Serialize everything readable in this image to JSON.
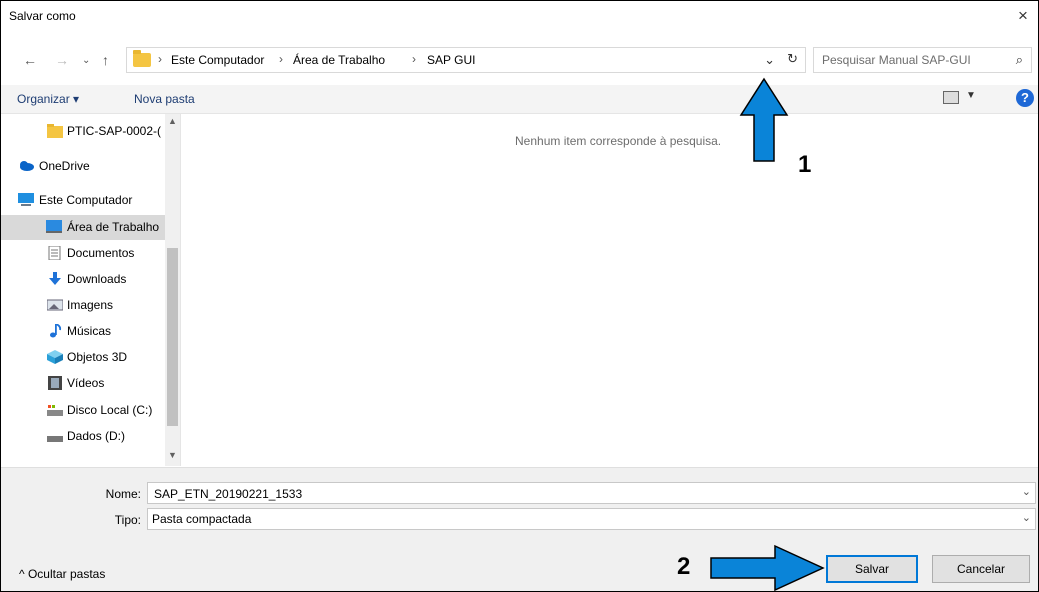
{
  "window": {
    "title": "Salvar como",
    "close_glyph": "×"
  },
  "address": {
    "segments": [
      "Este Computador",
      "Área de Trabalho",
      "SAP GUI"
    ],
    "separator": "›"
  },
  "search": {
    "placeholder": "Pesquisar Manual SAP-GUI"
  },
  "toolbar": {
    "organize_label": "Organizar ▾",
    "new_folder_label": "Nova pasta",
    "help_glyph": "?"
  },
  "nav_items": [
    {
      "label": "PTIC-SAP-0002-(",
      "icon": "folder-icon"
    },
    {
      "label": "OneDrive",
      "icon": "cloud-icon"
    },
    {
      "label": "Este Computador",
      "icon": "computer-icon"
    },
    {
      "label": "Área de Trabalho",
      "icon": "desktop-icon"
    },
    {
      "label": "Documentos",
      "icon": "document-icon"
    },
    {
      "label": "Downloads",
      "icon": "download-icon"
    },
    {
      "label": "Imagens",
      "icon": "image-icon"
    },
    {
      "label": "Músicas",
      "icon": "music-icon"
    },
    {
      "label": "Objetos 3D",
      "icon": "cube-icon"
    },
    {
      "label": "Vídeos",
      "icon": "video-icon"
    },
    {
      "label": "Disco Local (C:)",
      "icon": "drive-icon"
    },
    {
      "label": "Dados (D:)",
      "icon": "drive-icon"
    }
  ],
  "content": {
    "empty_message": "Nenhum item corresponde à pesquisa."
  },
  "form": {
    "name_label": "Nome:",
    "name_value": "SAP_ETN_20190221_1533",
    "type_label": "Tipo:",
    "type_value": "Pasta compactada"
  },
  "footer": {
    "hide_folders_label": "^  Ocultar pastas",
    "save_label": "Salvar",
    "cancel_label": "Cancelar"
  },
  "annotations": {
    "step1": "1",
    "step2": "2",
    "arrow_color": "#0a84d8"
  },
  "colors": {
    "accent": "#0078d7",
    "link": "#1e3d73",
    "selected": "#d9d9d9"
  }
}
